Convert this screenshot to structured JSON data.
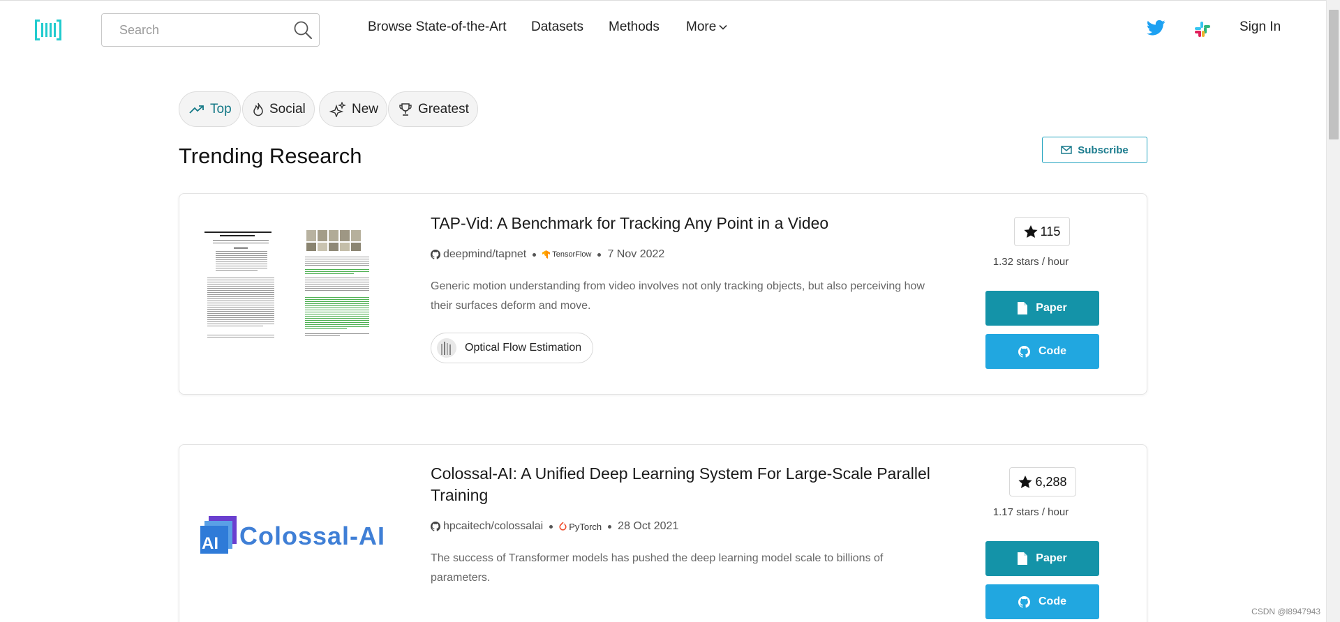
{
  "header": {
    "search_placeholder": "Search",
    "nav": [
      "Browse State-of-the-Art",
      "Datasets",
      "Methods",
      "More"
    ],
    "sign_in": "Sign In"
  },
  "filters": [
    {
      "label": "Top",
      "icon": "trending-up-icon",
      "active": true
    },
    {
      "label": "Social",
      "icon": "flame-icon",
      "active": false
    },
    {
      "label": "New",
      "icon": "sparkles-icon",
      "active": false
    },
    {
      "label": "Greatest",
      "icon": "trophy-icon",
      "active": false
    }
  ],
  "page_title": "Trending Research",
  "subscribe_label": "Subscribe",
  "papers": [
    {
      "title": "TAP-Vid: A Benchmark for Tracking Any Point in a Video",
      "repo": "deepmind/tapnet",
      "framework": "TensorFlow",
      "date": "7 Nov 2022",
      "abstract": "Generic motion understanding from video involves not only tracking objects, but also perceiving how their surfaces deform and move.",
      "task": "Optical Flow Estimation",
      "stars": "115",
      "rate": "1.32 stars / hour",
      "paper_label": "Paper",
      "code_label": "Code"
    },
    {
      "title": "Colossal-AI: A Unified Deep Learning System For Large-Scale Parallel Training",
      "repo": "hpcaitech/colossalai",
      "framework": "PyTorch",
      "date": "28 Oct 2021",
      "abstract": "The success of Transformer models has pushed the deep learning model scale to billions of parameters.",
      "logo_text": "Colossal-AI",
      "logo_badge": "AI",
      "stars": "6,288",
      "rate": "1.17 stars / hour",
      "paper_label": "Paper",
      "code_label": "Code"
    }
  ],
  "watermark": "CSDN @l8947943",
  "colors": {
    "accent": "#21a3bf",
    "paper_button": "#1493a8",
    "code_button": "#21a7e0",
    "tensorflow": "#ff8f00",
    "pytorch": "#ee4c2c",
    "twitter": "#1da1f2"
  }
}
